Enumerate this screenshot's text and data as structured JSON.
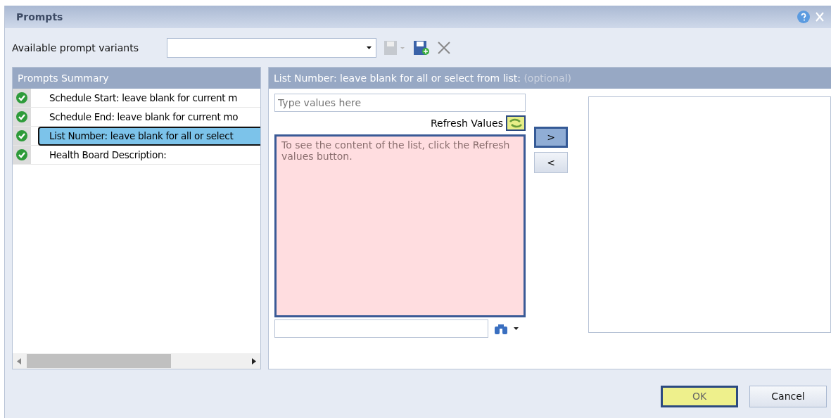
{
  "window": {
    "title": "Prompts"
  },
  "variants": {
    "label": "Available prompt variants"
  },
  "summary": {
    "title": "Prompts Summary",
    "items": [
      {
        "label": "Schedule Start: leave blank for current m",
        "done": true,
        "selected": false
      },
      {
        "label": "Schedule End: leave blank for current mo",
        "done": true,
        "selected": false
      },
      {
        "label": "List Number: leave blank for all or select",
        "done": true,
        "selected": true
      },
      {
        "label": "Health Board Description:",
        "done": true,
        "selected": false
      }
    ]
  },
  "detail": {
    "title": "List Number: leave blank for all or select from list:",
    "optional": "(optional)",
    "search": {
      "placeholder": "Type values here"
    },
    "refresh_label": "Refresh Values",
    "list_message": "To see the content of the list, click the Refresh values button.",
    "add": ">",
    "remove": "<"
  },
  "buttons": [
    {
      "label": "OK",
      "default": true
    },
    {
      "label": "Cancel",
      "default": false
    }
  ]
}
